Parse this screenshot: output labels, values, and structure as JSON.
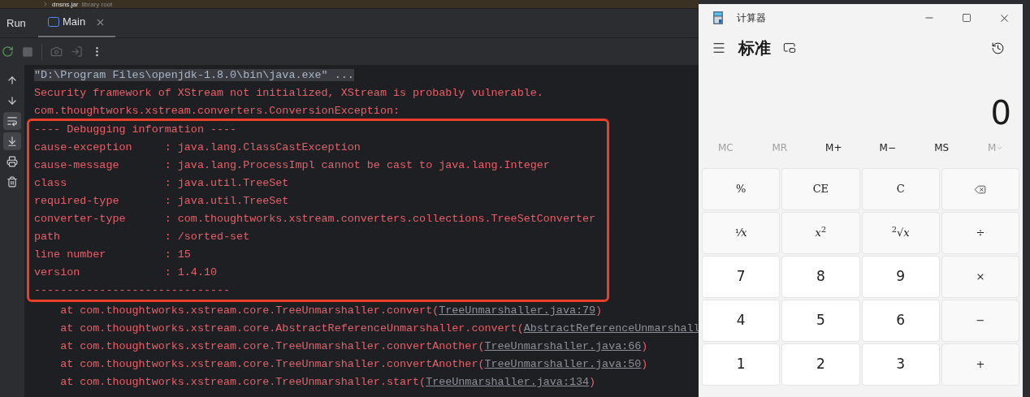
{
  "project_row": {
    "name": "dnsns.jar",
    "note": "library root"
  },
  "tool_window": {
    "title": "Run",
    "tabs": [
      {
        "label": "Main",
        "selected": true
      }
    ]
  },
  "side_tools": [
    {
      "kind": "up",
      "on": false
    },
    {
      "kind": "down",
      "on": false
    },
    {
      "kind": "wrap",
      "on": true
    },
    {
      "kind": "scroll_end",
      "on": true
    },
    {
      "kind": "print",
      "on": false
    },
    {
      "kind": "clear",
      "on": false
    }
  ],
  "console": {
    "lines": [
      {
        "kind": "command",
        "text": "\"D:\\Program Files\\openjdk-1.8.0\\bin\\java.exe\" ..."
      },
      {
        "kind": "error",
        "text": "Security framework of XStream not initialized, XStream is probably vulnerable."
      },
      {
        "kind": "error",
        "text": "com.thoughtworks.xstream.converters.ConversionException:"
      }
    ],
    "debug_block": [
      "---- Debugging information ----",
      "cause-exception     : java.lang.ClassCastException",
      "cause-message       : java.lang.ProcessImpl cannot be cast to java.lang.Integer",
      "class               : java.util.TreeSet",
      "required-type       : java.util.TreeSet",
      "converter-type      : com.thoughtworks.xstream.converters.collections.TreeSetConverter",
      "path                : /sorted-set",
      "line number         : 15",
      "version             : 1.4.10",
      "------------------------------"
    ],
    "trace": [
      {
        "text": "    at com.thoughtworks.xstream.core.TreeUnmarshaller.convert(",
        "link": "TreeUnmarshaller.java:79",
        "end": ")"
      },
      {
        "text": "    at com.thoughtworks.xstream.core.AbstractReferenceUnmarshaller.convert(",
        "link": "AbstractReferenceUnmarshall"
      },
      {
        "text": "    at com.thoughtworks.xstream.core.TreeUnmarshaller.convertAnother(",
        "link": "TreeUnmarshaller.java:66",
        "end": ")"
      },
      {
        "text": "    at com.thoughtworks.xstream.core.TreeUnmarshaller.convertAnother(",
        "link": "TreeUnmarshaller.java:50",
        "end": ")"
      },
      {
        "text": "    at com.thoughtworks.xstream.core.TreeUnmarshaller.start(",
        "link": "TreeUnmarshaller.java:134",
        "end": ")"
      }
    ]
  },
  "calculator": {
    "title": "计算器",
    "mode": "标准",
    "display": "0",
    "memory": [
      {
        "kind": "text",
        "label": "MC",
        "disabled": true
      },
      {
        "kind": "text",
        "label": "MR",
        "disabled": true
      },
      {
        "kind": "text",
        "label": "M+",
        "disabled": false
      },
      {
        "kind": "text",
        "label": "M−",
        "disabled": false
      },
      {
        "kind": "text",
        "label": "MS",
        "disabled": false
      },
      {
        "kind": "menu",
        "label": "M",
        "disabled": true
      }
    ],
    "keys": [
      {
        "kind": "function",
        "label": "%"
      },
      {
        "kind": "function",
        "label": "CE"
      },
      {
        "kind": "function",
        "label": "C"
      },
      {
        "kind": "backspace"
      },
      {
        "kind": "function",
        "label": "¹⁄*x*"
      },
      {
        "kind": "function",
        "label": "*x*$^{2}$"
      },
      {
        "kind": "function",
        "label": "$^{2}$√*x*"
      },
      {
        "kind": "function",
        "label": "÷"
      },
      {
        "kind": "digit",
        "label": "7"
      },
      {
        "kind": "digit",
        "label": "8"
      },
      {
        "kind": "digit",
        "label": "9"
      },
      {
        "kind": "function",
        "label": "×"
      },
      {
        "kind": "digit",
        "label": "4"
      },
      {
        "kind": "digit",
        "label": "5"
      },
      {
        "kind": "digit",
        "label": "6"
      },
      {
        "kind": "function",
        "label": "−"
      },
      {
        "kind": "digit",
        "label": "1"
      },
      {
        "kind": "digit",
        "label": "2"
      },
      {
        "kind": "digit",
        "label": "3"
      },
      {
        "kind": "function",
        "label": "+"
      }
    ]
  }
}
